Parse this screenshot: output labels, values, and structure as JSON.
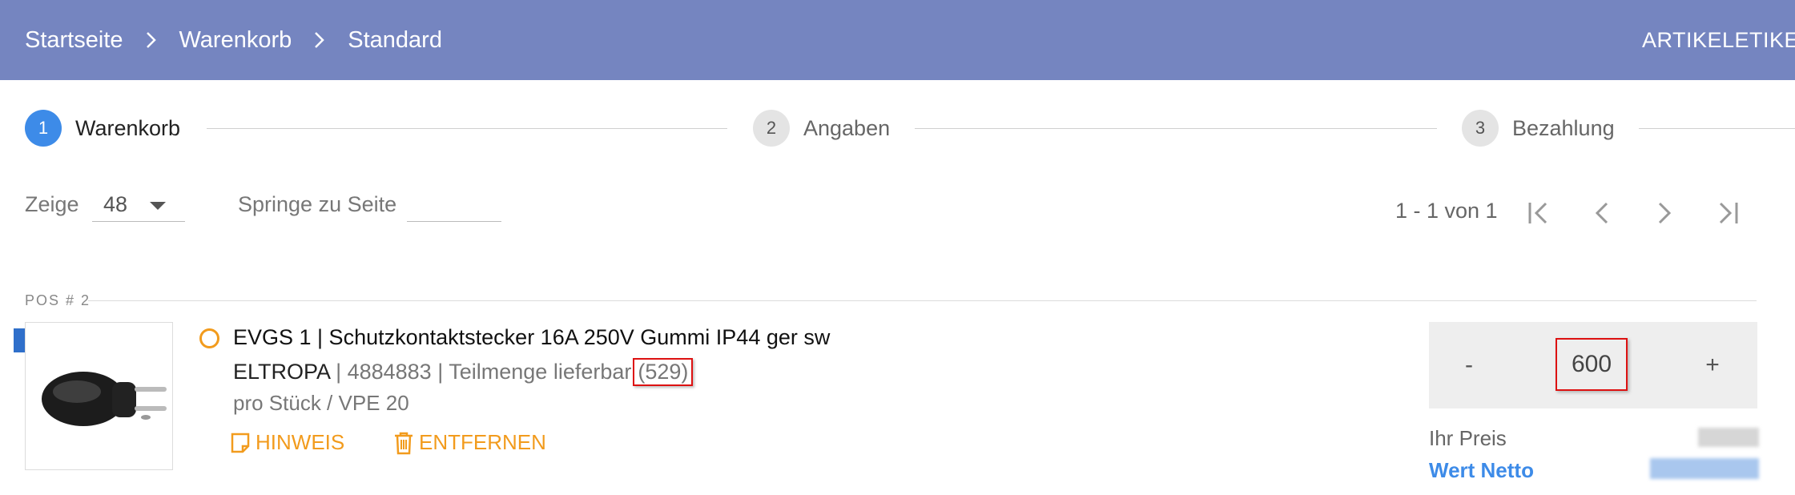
{
  "header": {
    "breadcrumb": [
      "Startseite",
      "Warenkorb",
      "Standard"
    ],
    "right_label": "ARTIKELETIKE"
  },
  "steps": [
    {
      "number": "1",
      "label": "Warenkorb",
      "active": true
    },
    {
      "number": "2",
      "label": "Angaben",
      "active": false
    },
    {
      "number": "3",
      "label": "Bezahlung",
      "active": false
    }
  ],
  "pager": {
    "show_label": "Zeige",
    "show_value": "48",
    "jump_label": "Springe zu Seite",
    "jump_value": "",
    "range_text": "1 - 1 von 1"
  },
  "position": {
    "label": "POS # 2",
    "title": "EVGS 1 | Schutzkontaktstecker 16A 250V Gummi IP44 ger sw",
    "brand": "ELTROPA",
    "article_number": "4884883",
    "availability": "Teilmenge lieferbar",
    "available_qty": "(529)",
    "unit": "pro Stück  / VPE 20",
    "actions": {
      "note": "HINWEIS",
      "remove": "ENTFERNEN"
    },
    "quantity": {
      "minus": "-",
      "value": "600",
      "plus": "+"
    },
    "price_label": "Ihr Preis",
    "net_label": "Wert Netto"
  },
  "colors": {
    "header_bg": "#7585c0",
    "accent_blue": "#3d8be8",
    "accent_orange": "#f29b1d",
    "highlight_red": "#dd1111"
  }
}
